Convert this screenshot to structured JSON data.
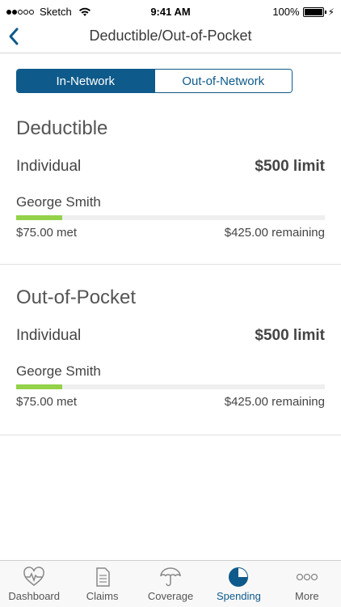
{
  "status_bar": {
    "carrier": "Sketch",
    "time": "9:41 AM",
    "battery": "100%"
  },
  "nav": {
    "title": "Deductible/Out-of-Pocket"
  },
  "tabs": {
    "in_network": "In-Network",
    "out_network": "Out-of-Network"
  },
  "sections": [
    {
      "title": "Deductible",
      "coverage": "Individual",
      "limit": "$500 limit",
      "member": "George Smith",
      "progress": 0.15,
      "met": "$75.00 met",
      "remaining": "$425.00 remaining"
    },
    {
      "title": "Out-of-Pocket",
      "coverage": "Individual",
      "limit": "$500 limit",
      "member": "George Smith",
      "progress": 0.15,
      "met": "$75.00 met",
      "remaining": "$425.00 remaining"
    }
  ],
  "tab_bar": {
    "dashboard": "Dashboard",
    "claims": "Claims",
    "coverage": "Coverage",
    "spending": "Spending",
    "more": "More"
  },
  "colors": {
    "primary": "#0e5a8a",
    "progress": "#93d249"
  }
}
